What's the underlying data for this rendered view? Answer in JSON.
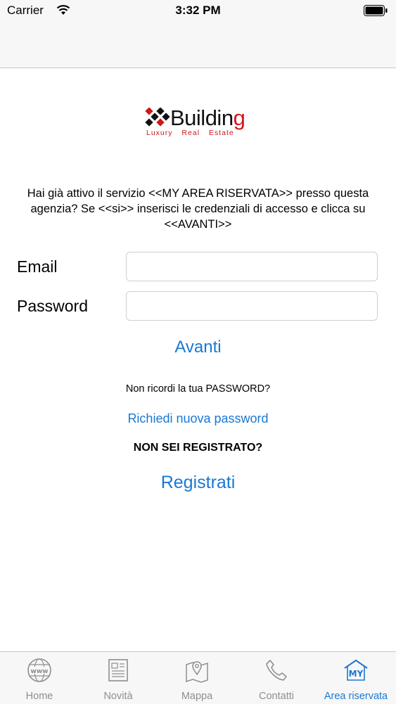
{
  "status_bar": {
    "carrier": "Carrier",
    "time": "3:32 PM"
  },
  "logo": {
    "wordmark": "Buildin",
    "wordmark_end": "g",
    "tagline": "Luxury Real Estate"
  },
  "intro_text": "Hai già attivo il servizio <<MY AREA RISERVATA>> presso questa agenzia? Se <<si>> inserisci le credenziali di accesso e clicca su <<AVANTI>>",
  "form": {
    "email_label": "Email",
    "email_value": "",
    "password_label": "Password",
    "password_value": "",
    "submit_label": "Avanti"
  },
  "forgot_text": "Non ricordi la tua PASSWORD?",
  "reset_link": "Richiedi nuova password",
  "not_registered_text": "NON SEI REGISTRATO?",
  "register_link": "Registrati",
  "tabs": [
    {
      "label": "Home",
      "icon": "globe-www-icon"
    },
    {
      "label": "Novità",
      "icon": "newspaper-icon"
    },
    {
      "label": "Mappa",
      "icon": "map-pin-icon"
    },
    {
      "label": "Contatti",
      "icon": "phone-icon"
    },
    {
      "label": "Area riservata",
      "icon": "my-house-icon",
      "badge": "MY",
      "active": true
    }
  ],
  "colors": {
    "accent": "#1a78d4",
    "brand_red": "#d0161c",
    "inactive": "#8e8e93"
  }
}
